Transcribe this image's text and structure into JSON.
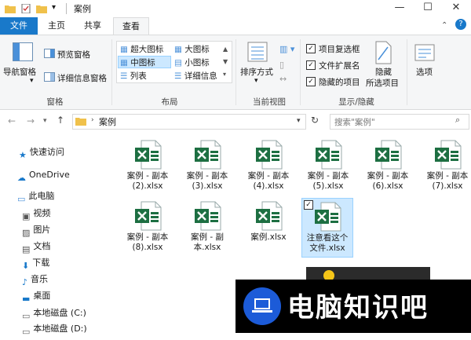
{
  "window": {
    "title": "案例"
  },
  "ribbon_tabs": [
    "文件",
    "主页",
    "共享",
    "查看"
  ],
  "ribbon": {
    "pane_group": {
      "nav_pane": "导航窗格",
      "preview_pane": "预览窗格",
      "details_pane": "详细信息窗格",
      "label": "窗格"
    },
    "layout_group": {
      "items": [
        "超大图标",
        "大图标",
        "中图标",
        "小图标",
        "列表",
        "详细信息"
      ],
      "selected": "中图标",
      "label": "布局"
    },
    "current_view_group": {
      "sort_by": "排序方式",
      "label": "当前视图"
    },
    "show_hide_group": {
      "item_checkboxes": "项目复选框",
      "file_extensions": "文件扩展名",
      "hidden_items": "隐藏的项目",
      "hide_selected_line1": "隐藏",
      "hide_selected_line2": "所选项目",
      "label": "显示/隐藏"
    },
    "options": "选项"
  },
  "address": {
    "path": "案例",
    "search_placeholder": "搜索\"案例\""
  },
  "nav_pane": {
    "items": [
      "快速访问",
      "OneDrive",
      "此电脑",
      "视频",
      "图片",
      "文档",
      "下载",
      "音乐",
      "桌面",
      "本地磁盘 (C:)",
      "本地磁盘 (D:)"
    ]
  },
  "files": [
    {
      "line1": "案例 - 副本",
      "line2": "(2).xlsx"
    },
    {
      "line1": "案例 - 副本",
      "line2": "(3).xlsx"
    },
    {
      "line1": "案例 - 副本",
      "line2": "(4).xlsx"
    },
    {
      "line1": "案例 - 副本",
      "line2": "(5).xlsx"
    },
    {
      "line1": "案例 - 副本",
      "line2": "(6).xlsx"
    },
    {
      "line1": "案例 - 副本",
      "line2": "(7).xlsx"
    },
    {
      "line1": "案例 - 副本",
      "line2": "(8).xlsx"
    },
    {
      "line1": "案例 - 副",
      "line2": "本.xlsx"
    },
    {
      "line1": "案例.xlsx",
      "line2": ""
    },
    {
      "line1": "注意看这个",
      "line2": "文件.xlsx"
    }
  ],
  "watermark": {
    "text": "电脑知识吧"
  },
  "colors": {
    "accent": "#1979ca",
    "excel_green": "#1d6f42",
    "selection": "#cce8ff"
  }
}
